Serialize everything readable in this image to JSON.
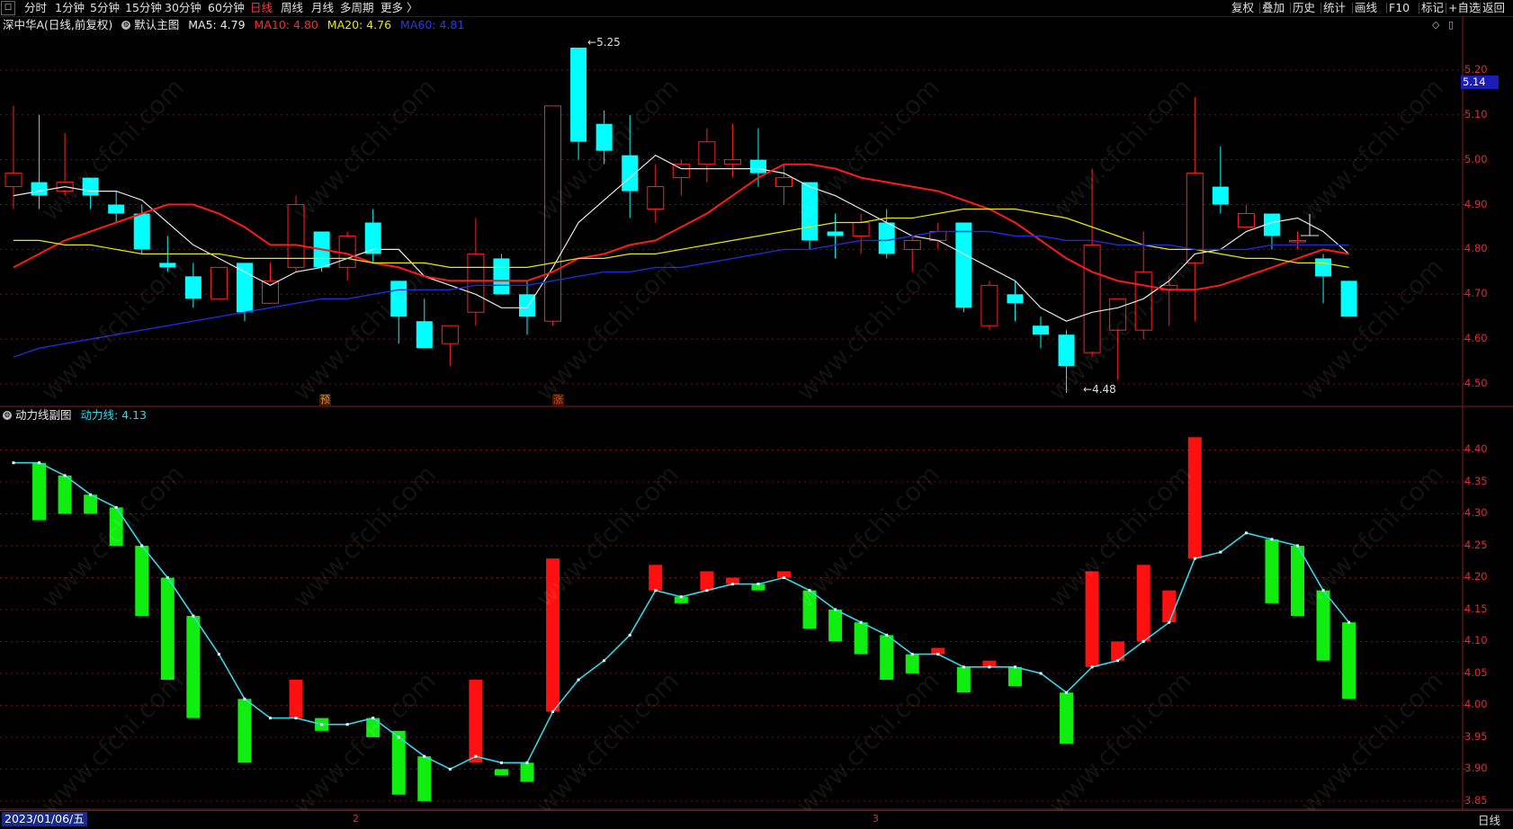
{
  "toolbar": {
    "logo": "口",
    "left_items": [
      "分时",
      "1分钟",
      "5分钟",
      "15分钟",
      "30分钟",
      "60分钟",
      "日线",
      "周线",
      "月线",
      "多周期",
      "更多 〉"
    ],
    "active_item": "日线",
    "right_items": [
      "复权",
      "叠加",
      "历史",
      "统计",
      "画线",
      "F10",
      "标记",
      "+自选",
      "返回"
    ]
  },
  "main_chart": {
    "title": "深中华A(日线,前复权)",
    "indicator_name": "默认主图",
    "ma5_label": "MA5: 4.79",
    "ma10_label": "MA10: 4.80",
    "ma20_label": "MA20: 4.76",
    "ma60_label": "MA60: 4.81",
    "high_label": "5.25",
    "low_label": "4.48",
    "current_price": "5.14",
    "signal_a": "预",
    "signal_b": "涨",
    "icons": [
      "diamond-icon",
      "panel-icon"
    ]
  },
  "sub_chart": {
    "title": "动力线副图",
    "line_label": "动力线: 4.13"
  },
  "status": {
    "date": "2023/01/06/五",
    "month_marks": [
      "2",
      "3"
    ],
    "period": "日线"
  },
  "watermark": "www.cfchi.com",
  "colors": {
    "up": "#ff2020",
    "down": "#00ffff",
    "ma5": "#e8e8e8",
    "ma10": "#ff1a1a",
    "ma20": "#e8e800",
    "ma60": "#1e2bd8",
    "bar_up": "#ff1010",
    "bar_down": "#10ee10",
    "power_line": "#33d6e6",
    "grid": "#7a0e0e"
  },
  "chart_data": [
    {
      "type": "candlestick",
      "title": "深中华A(日线,前复权)",
      "ylim": [
        4.45,
        5.28
      ],
      "yticks": [
        4.5,
        4.6,
        4.7,
        4.8,
        4.9,
        5.0,
        5.1,
        5.2
      ],
      "candles": [
        {
          "o": 4.94,
          "h": 5.12,
          "l": 4.89,
          "c": 4.97
        },
        {
          "o": 4.95,
          "h": 5.1,
          "l": 4.89,
          "c": 4.92
        },
        {
          "o": 4.93,
          "h": 5.06,
          "l": 4.92,
          "c": 4.95
        },
        {
          "o": 4.96,
          "h": 4.96,
          "l": 4.89,
          "c": 4.92
        },
        {
          "o": 4.9,
          "h": 4.93,
          "l": 4.86,
          "c": 4.88
        },
        {
          "o": 4.88,
          "h": 4.9,
          "l": 4.79,
          "c": 4.8
        },
        {
          "o": 4.77,
          "h": 4.83,
          "l": 4.75,
          "c": 4.76
        },
        {
          "o": 4.74,
          "h": 4.77,
          "l": 4.67,
          "c": 4.69
        },
        {
          "o": 4.69,
          "h": 4.76,
          "l": 4.69,
          "c": 4.76
        },
        {
          "o": 4.77,
          "h": 4.77,
          "l": 4.64,
          "c": 4.66
        },
        {
          "o": 4.68,
          "h": 4.77,
          "l": 4.68,
          "c": 4.73
        },
        {
          "o": 4.76,
          "h": 4.92,
          "l": 4.75,
          "c": 4.9
        },
        {
          "o": 4.84,
          "h": 4.84,
          "l": 4.75,
          "c": 4.76
        },
        {
          "o": 4.76,
          "h": 4.84,
          "l": 4.73,
          "c": 4.83
        },
        {
          "o": 4.86,
          "h": 4.89,
          "l": 4.77,
          "c": 4.79
        },
        {
          "o": 4.73,
          "h": 4.73,
          "l": 4.59,
          "c": 4.65
        },
        {
          "o": 4.64,
          "h": 4.69,
          "l": 4.58,
          "c": 4.58
        },
        {
          "o": 4.59,
          "h": 4.63,
          "l": 4.54,
          "c": 4.63
        },
        {
          "o": 4.66,
          "h": 4.87,
          "l": 4.63,
          "c": 4.79
        },
        {
          "o": 4.78,
          "h": 4.79,
          "l": 4.7,
          "c": 4.7
        },
        {
          "o": 4.7,
          "h": 4.73,
          "l": 4.61,
          "c": 4.65
        },
        {
          "o": 4.64,
          "h": 5.12,
          "l": 4.63,
          "c": 5.12
        },
        {
          "o": 5.25,
          "h": 5.25,
          "l": 5.0,
          "c": 5.04
        },
        {
          "o": 5.08,
          "h": 5.11,
          "l": 4.99,
          "c": 5.02
        },
        {
          "o": 5.01,
          "h": 5.1,
          "l": 4.87,
          "c": 4.93
        },
        {
          "o": 4.89,
          "h": 4.99,
          "l": 4.86,
          "c": 4.94
        },
        {
          "o": 4.96,
          "h": 5.0,
          "l": 4.92,
          "c": 4.99
        },
        {
          "o": 4.99,
          "h": 5.07,
          "l": 4.95,
          "c": 5.04
        },
        {
          "o": 4.99,
          "h": 5.08,
          "l": 4.96,
          "c": 5.0
        },
        {
          "o": 5.0,
          "h": 5.07,
          "l": 4.94,
          "c": 4.97
        },
        {
          "o": 4.94,
          "h": 4.99,
          "l": 4.9,
          "c": 4.96
        },
        {
          "o": 4.95,
          "h": 4.95,
          "l": 4.8,
          "c": 4.82
        },
        {
          "o": 4.84,
          "h": 4.88,
          "l": 4.78,
          "c": 4.83
        },
        {
          "o": 4.83,
          "h": 4.88,
          "l": 4.79,
          "c": 4.86
        },
        {
          "o": 4.86,
          "h": 4.89,
          "l": 4.78,
          "c": 4.79
        },
        {
          "o": 4.8,
          "h": 4.83,
          "l": 4.75,
          "c": 4.82
        },
        {
          "o": 4.82,
          "h": 4.86,
          "l": 4.8,
          "c": 4.84
        },
        {
          "o": 4.86,
          "h": 4.86,
          "l": 4.66,
          "c": 4.67
        },
        {
          "o": 4.63,
          "h": 4.73,
          "l": 4.62,
          "c": 4.72
        },
        {
          "o": 4.7,
          "h": 4.73,
          "l": 4.64,
          "c": 4.68
        },
        {
          "o": 4.63,
          "h": 4.65,
          "l": 4.58,
          "c": 4.61
        },
        {
          "o": 4.61,
          "h": 4.62,
          "l": 4.48,
          "c": 4.54
        },
        {
          "o": 4.57,
          "h": 4.98,
          "l": 4.56,
          "c": 4.81
        },
        {
          "o": 4.62,
          "h": 4.69,
          "l": 4.51,
          "c": 4.69
        },
        {
          "o": 4.62,
          "h": 4.84,
          "l": 4.6,
          "c": 4.75
        },
        {
          "o": 4.71,
          "h": 4.74,
          "l": 4.63,
          "c": 4.72
        },
        {
          "o": 4.77,
          "h": 5.14,
          "l": 4.64,
          "c": 4.97
        },
        {
          "o": 4.94,
          "h": 5.03,
          "l": 4.88,
          "c": 4.9
        },
        {
          "o": 4.85,
          "h": 4.9,
          "l": 4.85,
          "c": 4.88
        },
        {
          "o": 4.88,
          "h": 4.88,
          "l": 4.8,
          "c": 4.83
        },
        {
          "o": 4.82,
          "h": 4.84,
          "l": 4.8,
          "c": 4.82
        },
        {
          "o": 4.78,
          "h": 4.79,
          "l": 4.68,
          "c": 4.74
        },
        {
          "o": 4.73,
          "h": 4.73,
          "l": 4.65,
          "c": 4.65
        }
      ],
      "series": [
        {
          "name": "MA5",
          "values": [
            4.92,
            4.93,
            4.94,
            4.93,
            4.93,
            4.91,
            4.86,
            4.81,
            4.78,
            4.75,
            4.72,
            4.75,
            4.76,
            4.78,
            4.8,
            4.8,
            4.74,
            4.72,
            4.7,
            4.67,
            4.67,
            4.76,
            4.86,
            4.91,
            4.96,
            5.01,
            4.98,
            4.98,
            4.98,
            4.98,
            4.97,
            4.94,
            4.92,
            4.89,
            4.86,
            4.83,
            4.82,
            4.79,
            4.76,
            4.73,
            4.67,
            4.64,
            4.66,
            4.67,
            4.69,
            4.73,
            4.79,
            4.8,
            4.84,
            4.86,
            4.87,
            4.84,
            4.79
          ]
        },
        {
          "name": "MA10",
          "values": [
            4.76,
            4.79,
            4.82,
            4.84,
            4.86,
            4.88,
            4.9,
            4.9,
            4.88,
            4.85,
            4.81,
            4.81,
            4.8,
            4.79,
            4.77,
            4.76,
            4.74,
            4.73,
            4.73,
            4.73,
            4.73,
            4.75,
            4.78,
            4.79,
            4.81,
            4.82,
            4.85,
            4.88,
            4.92,
            4.96,
            4.99,
            4.99,
            4.98,
            4.96,
            4.95,
            4.94,
            4.93,
            4.91,
            4.89,
            4.86,
            4.82,
            4.78,
            4.75,
            4.73,
            4.72,
            4.71,
            4.71,
            4.72,
            4.74,
            4.76,
            4.78,
            4.8,
            4.79
          ]
        },
        {
          "name": "MA20",
          "values": [
            4.82,
            4.82,
            4.81,
            4.81,
            4.8,
            4.79,
            4.79,
            4.79,
            4.79,
            4.78,
            4.78,
            4.78,
            4.78,
            4.78,
            4.77,
            4.77,
            4.77,
            4.76,
            4.76,
            4.76,
            4.76,
            4.77,
            4.78,
            4.78,
            4.79,
            4.79,
            4.8,
            4.81,
            4.82,
            4.83,
            4.84,
            4.85,
            4.86,
            4.86,
            4.87,
            4.87,
            4.88,
            4.89,
            4.89,
            4.89,
            4.88,
            4.87,
            4.85,
            4.83,
            4.81,
            4.8,
            4.8,
            4.79,
            4.78,
            4.78,
            4.77,
            4.77,
            4.76
          ]
        },
        {
          "name": "MA60",
          "values": [
            4.56,
            4.58,
            4.59,
            4.6,
            4.61,
            4.62,
            4.63,
            4.64,
            4.65,
            4.66,
            4.67,
            4.68,
            4.69,
            4.69,
            4.7,
            4.71,
            4.71,
            4.71,
            4.72,
            4.72,
            4.72,
            4.73,
            4.74,
            4.75,
            4.75,
            4.76,
            4.76,
            4.77,
            4.78,
            4.79,
            4.8,
            4.8,
            4.81,
            4.82,
            4.82,
            4.83,
            4.84,
            4.84,
            4.84,
            4.83,
            4.83,
            4.82,
            4.82,
            4.81,
            4.81,
            4.81,
            4.8,
            4.8,
            4.8,
            4.81,
            4.81,
            4.81,
            4.81
          ]
        }
      ]
    },
    {
      "type": "bar",
      "title": "动力线副图",
      "ylim": [
        3.84,
        4.45
      ],
      "yticks": [
        3.85,
        3.9,
        3.95,
        4.0,
        4.05,
        4.1,
        4.15,
        4.2,
        4.25,
        4.3,
        4.35,
        4.4
      ],
      "series": [
        {
          "name": "动力线",
          "values": [
            4.38,
            4.38,
            4.36,
            4.33,
            4.31,
            4.25,
            4.2,
            4.14,
            4.08,
            4.01,
            3.98,
            3.98,
            3.97,
            3.97,
            3.98,
            3.95,
            3.92,
            3.9,
            3.92,
            3.91,
            3.91,
            3.99,
            4.04,
            4.07,
            4.11,
            4.18,
            4.17,
            4.18,
            4.19,
            4.19,
            4.2,
            4.18,
            4.15,
            4.13,
            4.11,
            4.08,
            4.08,
            4.06,
            4.06,
            4.06,
            4.05,
            4.02,
            4.06,
            4.07,
            4.1,
            4.13,
            4.23,
            4.24,
            4.27,
            4.26,
            4.25,
            4.18,
            4.13
          ]
        }
      ],
      "bars": [
        {
          "o": 4.38,
          "c": 4.29
        },
        {
          "o": 4.36,
          "c": 4.3
        },
        {
          "o": 4.33,
          "c": 4.3
        },
        {
          "o": 4.31,
          "c": 4.25
        },
        {
          "o": 4.25,
          "c": 4.14
        },
        {
          "o": 4.2,
          "c": 4.04
        },
        {
          "o": 4.14,
          "c": 3.98
        },
        {
          "o": 4.08,
          "c": 4.08
        },
        {
          "o": 4.01,
          "c": 3.91
        },
        {
          "o": 3.98,
          "c": 3.98
        },
        {
          "o": 3.98,
          "c": 4.04
        },
        {
          "o": 3.98,
          "c": 3.96
        },
        {
          "o": 3.97,
          "c": 3.97
        },
        {
          "o": 3.98,
          "c": 3.95
        },
        {
          "o": 3.96,
          "c": 3.86
        },
        {
          "o": 3.92,
          "c": 3.85
        },
        {
          "o": 3.9,
          "c": 3.9
        },
        {
          "o": 3.91,
          "c": 4.04
        },
        {
          "o": 3.9,
          "c": 3.89
        },
        {
          "o": 3.91,
          "c": 3.88
        },
        {
          "o": 3.99,
          "c": 4.23
        },
        {
          "o": 4.04,
          "c": 4.04
        },
        {
          "o": 4.07,
          "c": 4.07
        },
        {
          "o": 4.11,
          "c": 4.11
        },
        {
          "o": 4.18,
          "c": 4.22
        },
        {
          "o": 4.17,
          "c": 4.16
        },
        {
          "o": 4.18,
          "c": 4.21
        },
        {
          "o": 4.19,
          "c": 4.2
        },
        {
          "o": 4.19,
          "c": 4.18
        },
        {
          "o": 4.2,
          "c": 4.21
        },
        {
          "o": 4.18,
          "c": 4.12
        },
        {
          "o": 4.15,
          "c": 4.1
        },
        {
          "o": 4.13,
          "c": 4.08
        },
        {
          "o": 4.11,
          "c": 4.04
        },
        {
          "o": 4.08,
          "c": 4.05
        },
        {
          "o": 4.08,
          "c": 4.09
        },
        {
          "o": 4.06,
          "c": 4.02
        },
        {
          "o": 4.06,
          "c": 4.07
        },
        {
          "o": 4.06,
          "c": 4.03
        },
        {
          "o": 4.05,
          "c": 4.05
        },
        {
          "o": 4.02,
          "c": 3.94
        },
        {
          "o": 4.06,
          "c": 4.21
        },
        {
          "o": 4.07,
          "c": 4.1
        },
        {
          "o": 4.1,
          "c": 4.22
        },
        {
          "o": 4.13,
          "c": 4.18
        },
        {
          "o": 4.23,
          "c": 4.42
        },
        {
          "o": 4.24,
          "c": 4.24
        },
        {
          "o": 4.27,
          "c": 4.27
        },
        {
          "o": 4.26,
          "c": 4.16
        },
        {
          "o": 4.25,
          "c": 4.14
        },
        {
          "o": 4.18,
          "c": 4.07
        },
        {
          "o": 4.13,
          "c": 4.01
        }
      ]
    }
  ]
}
